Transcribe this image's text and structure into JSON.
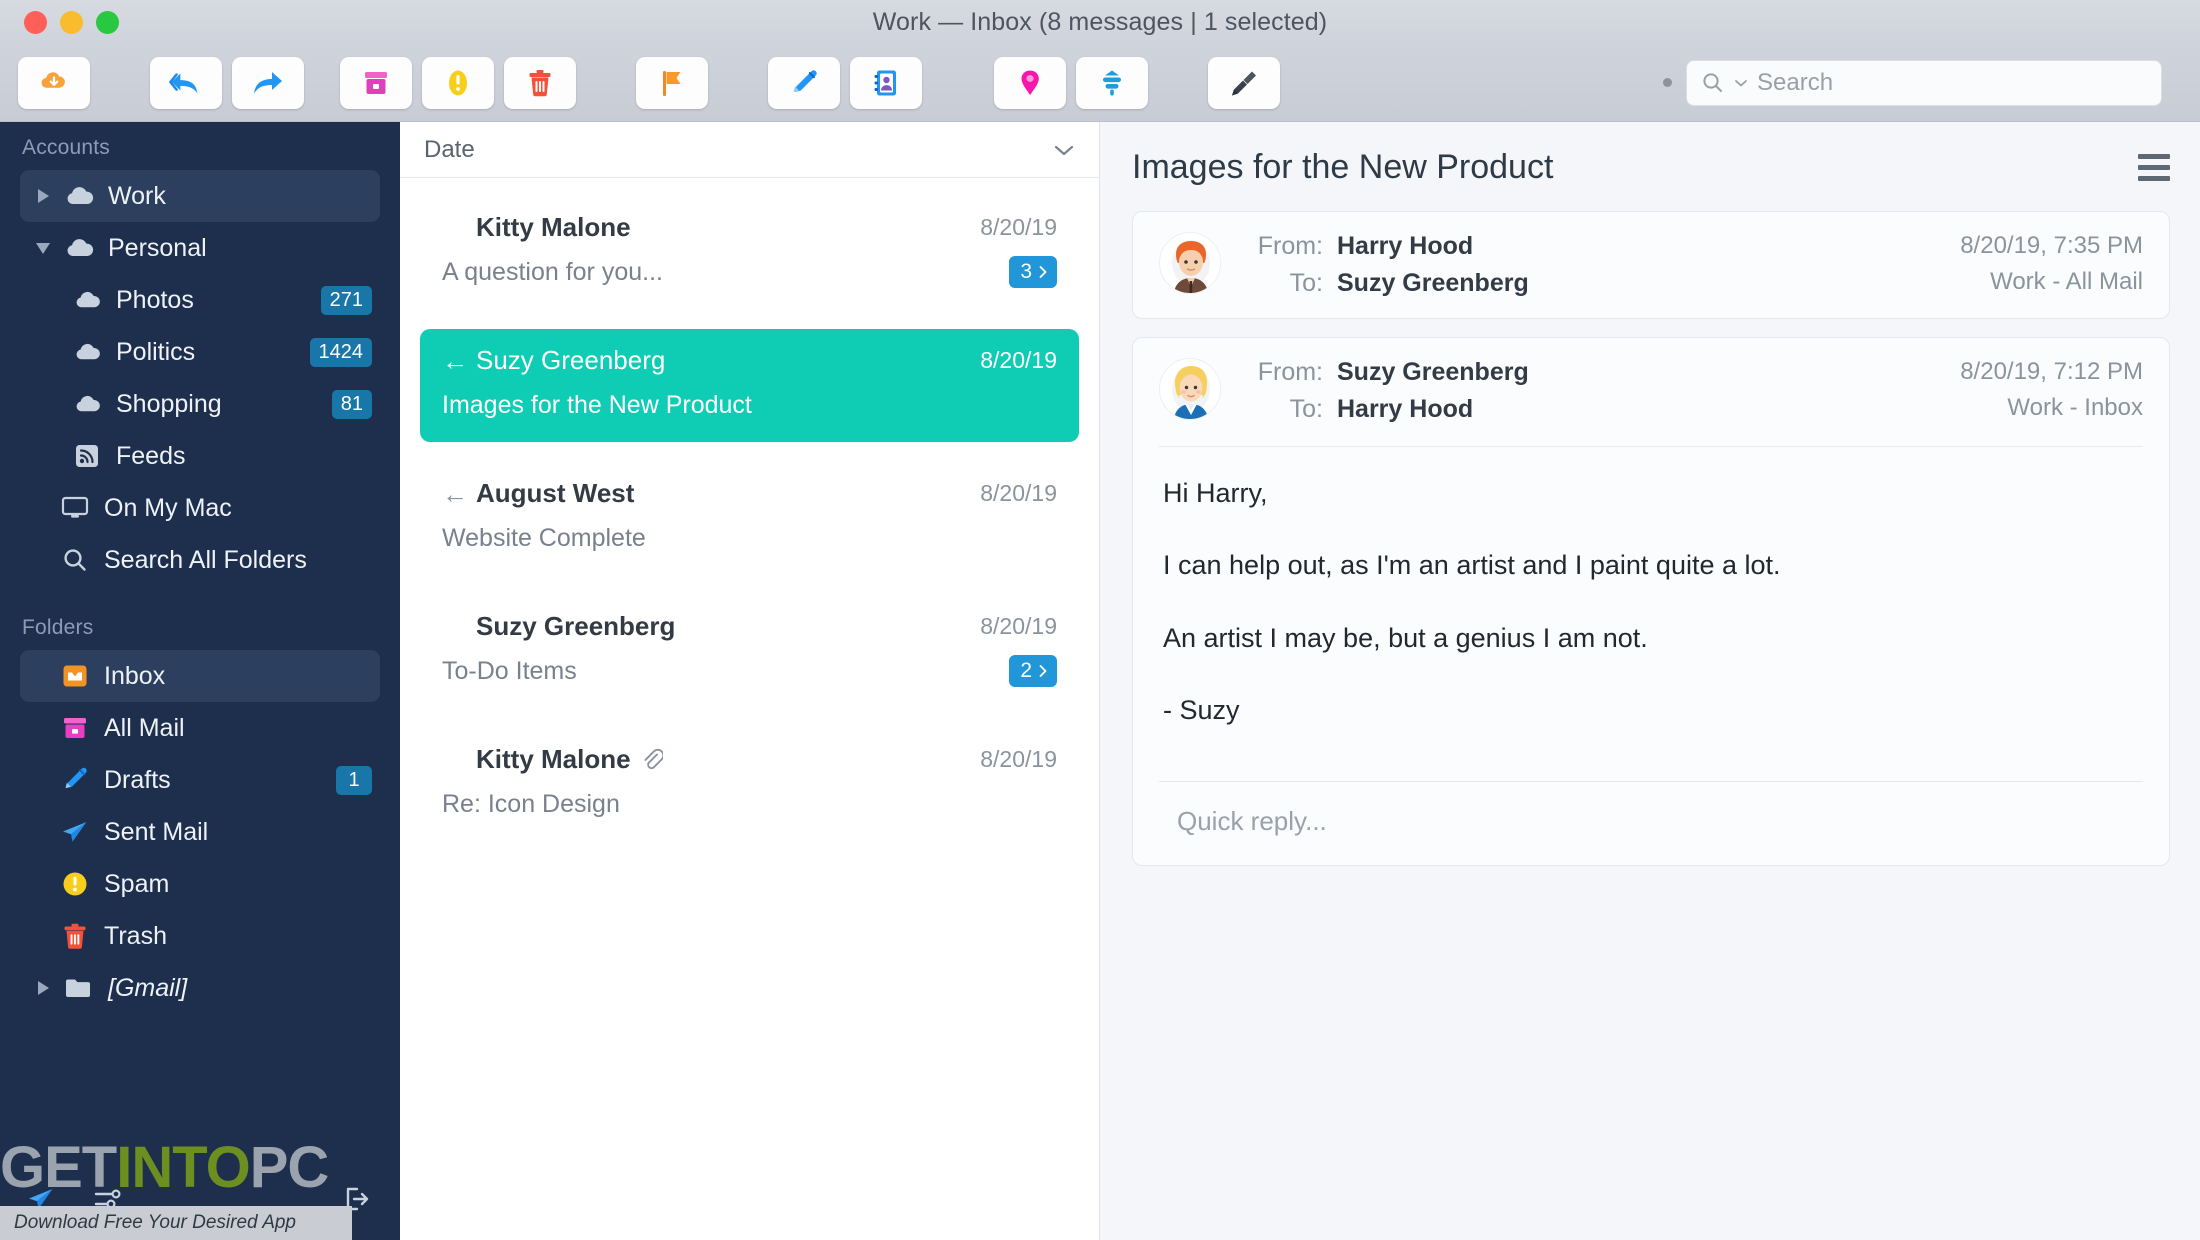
{
  "window": {
    "title": "Work — Inbox (8 messages | 1 selected)",
    "traffic_lights": [
      "close",
      "minimize",
      "maximize"
    ]
  },
  "toolbar": {
    "buttons": [
      {
        "name": "get-mail-button",
        "icon": "cloud-download-icon"
      },
      {
        "name": "reply-all-button",
        "icon": "reply-all-icon"
      },
      {
        "name": "forward-button",
        "icon": "forward-arrow-icon"
      },
      {
        "name": "archive-button",
        "icon": "archive-box-icon"
      },
      {
        "name": "spam-button",
        "icon": "warning-circle-icon"
      },
      {
        "name": "delete-button",
        "icon": "trash-icon"
      },
      {
        "name": "flag-button",
        "icon": "flag-icon"
      },
      {
        "name": "compose-button",
        "icon": "pencil-icon"
      },
      {
        "name": "contacts-button",
        "icon": "address-book-icon"
      },
      {
        "name": "pin-button",
        "icon": "map-pin-icon"
      },
      {
        "name": "filter-button",
        "icon": "filter-icon"
      },
      {
        "name": "cleanup-button",
        "icon": "paint-brush-icon"
      }
    ],
    "search": {
      "placeholder": "Search",
      "icon": "search-icon",
      "chevron": "chevron-down-icon"
    }
  },
  "sidebar": {
    "accounts_header": "Accounts",
    "accounts": [
      {
        "label": "Work",
        "icon": "cloud-icon",
        "disclosure": "right",
        "active": true,
        "indent": 0,
        "badge": null
      },
      {
        "label": "Personal",
        "icon": "cloud-icon",
        "disclosure": "down",
        "active": false,
        "indent": 0,
        "badge": null
      },
      {
        "label": "Photos",
        "icon": "cloud-icon",
        "disclosure": null,
        "active": false,
        "indent": 1,
        "badge": "271"
      },
      {
        "label": "Politics",
        "icon": "cloud-icon",
        "disclosure": null,
        "active": false,
        "indent": 1,
        "badge": "1424"
      },
      {
        "label": "Shopping",
        "icon": "cloud-icon",
        "disclosure": null,
        "active": false,
        "indent": 1,
        "badge": "81"
      },
      {
        "label": "Feeds",
        "icon": "rss-icon",
        "disclosure": null,
        "active": false,
        "indent": 1,
        "badge": null
      },
      {
        "label": "On My Mac",
        "icon": "monitor-icon",
        "disclosure": null,
        "active": false,
        "indent": 0,
        "badge": null
      },
      {
        "label": "Search All Folders",
        "icon": "search-icon",
        "disclosure": null,
        "active": false,
        "indent": 0,
        "badge": null
      }
    ],
    "folders_header": "Folders",
    "folders": [
      {
        "label": "Inbox",
        "icon": "inbox-tray-icon",
        "disclosure": null,
        "active": true,
        "badge": null
      },
      {
        "label": "All Mail",
        "icon": "archive-box-icon",
        "disclosure": null,
        "active": false,
        "badge": null
      },
      {
        "label": "Drafts",
        "icon": "pencil-icon",
        "disclosure": null,
        "active": false,
        "badge": "1"
      },
      {
        "label": "Sent Mail",
        "icon": "paper-plane-icon",
        "disclosure": null,
        "active": false,
        "badge": null
      },
      {
        "label": "Spam",
        "icon": "warning-circle-icon",
        "disclosure": null,
        "active": false,
        "badge": null
      },
      {
        "label": "Trash",
        "icon": "trash-icon",
        "disclosure": null,
        "active": false,
        "badge": null
      },
      {
        "label": "[Gmail]",
        "icon": "folder-icon",
        "disclosure": "right",
        "active": false,
        "badge": null,
        "italic": true
      }
    ],
    "bottom_icons": [
      "paper-plane-icon",
      "sliders-icon",
      "logout-icon"
    ]
  },
  "watermark": {
    "part1": "GET ",
    "part2": "INTO",
    "part3": " PC",
    "subtitle": "Download Free Your Desired App"
  },
  "message_list": {
    "sort_label": "Date",
    "sort_chevron": "chevron-down-icon",
    "rows": [
      {
        "sender": "Kitty Malone",
        "subject": "A question for you...",
        "date": "8/20/19",
        "thread": "3",
        "replied": false,
        "attachment": false,
        "selected": false
      },
      {
        "sender": "Suzy Greenberg",
        "subject": "Images for the New Product",
        "date": "8/20/19",
        "thread": null,
        "replied": true,
        "attachment": false,
        "selected": true
      },
      {
        "sender": "August West",
        "subject": "Website Complete",
        "date": "8/20/19",
        "thread": null,
        "replied": true,
        "attachment": false,
        "selected": false
      },
      {
        "sender": "Suzy Greenberg",
        "subject": "To-Do Items",
        "date": "8/20/19",
        "thread": "2",
        "replied": false,
        "attachment": false,
        "selected": false
      },
      {
        "sender": "Kitty Malone",
        "subject": "Re: Icon Design",
        "date": "8/20/19",
        "thread": null,
        "replied": false,
        "attachment": true,
        "selected": false
      }
    ]
  },
  "reader": {
    "title": "Images for the New Product",
    "menu_icon": "hamburger-menu-icon",
    "messages": [
      {
        "from_label": "From:",
        "from": "Harry Hood",
        "to_label": "To:",
        "to": "Suzy Greenberg",
        "date": "8/20/19, 7:35 PM",
        "mailbox": "Work - All Mail",
        "avatar": "harry-avatar",
        "expanded": false
      },
      {
        "from_label": "From:",
        "from": "Suzy Greenberg",
        "to_label": "To:",
        "to": "Harry Hood",
        "date": "8/20/19, 7:12 PM",
        "mailbox": "Work - Inbox",
        "avatar": "suzy-avatar",
        "expanded": true,
        "body": [
          "Hi Harry,",
          "I can help out, as I'm an artist and I paint quite a lot.",
          "An artist I may be, but a genius I am not.",
          "- Suzy"
        ],
        "quick_reply_placeholder": "Quick reply..."
      }
    ]
  },
  "colors": {
    "sidebar_bg": "#1d2f4c",
    "sidebar_active": "#2c3f5e",
    "selection_teal": "#0fcdb4",
    "badge_blue": "#1877a8",
    "thread_blue": "#2196d9",
    "reader_bg": "#f4f6f9",
    "titlebar_bg": "#d2d6de"
  }
}
